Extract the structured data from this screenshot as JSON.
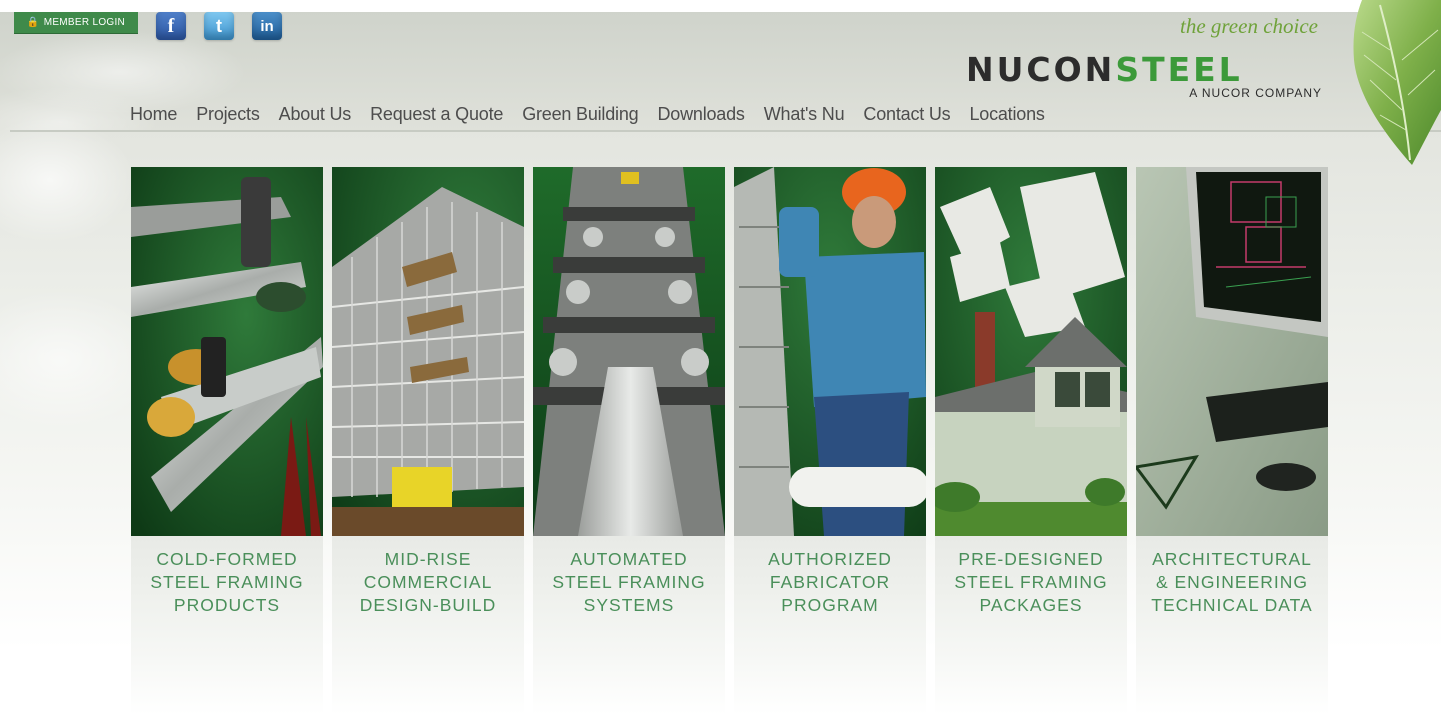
{
  "header": {
    "member_login": "MEMBER LOGIN",
    "social": [
      {
        "name": "facebook",
        "glyph": "f"
      },
      {
        "name": "twitter",
        "glyph": "t"
      },
      {
        "name": "linkedin",
        "glyph": "in"
      }
    ],
    "tagline": "the green choice",
    "logo": {
      "part1": "NUCON",
      "part2": "STEEL",
      "sub": "A NUCOR COMPANY"
    }
  },
  "nav": [
    "Home",
    "Projects",
    "About Us",
    "Request a Quote",
    "Green Building",
    "Downloads",
    "What's Nu",
    "Contact Us",
    "Locations"
  ],
  "panels": [
    {
      "lines": [
        "COLD-FORMED",
        "STEEL FRAMING",
        "PRODUCTS"
      ],
      "image": "cold-formed-steel-framing-photo"
    },
    {
      "lines": [
        "MID-RISE",
        "COMMERCIAL",
        "DESIGN-BUILD"
      ],
      "image": "mid-rise-building-photo"
    },
    {
      "lines": [
        "AUTOMATED",
        "STEEL FRAMING",
        "SYSTEMS"
      ],
      "image": "roll-forming-machine-photo"
    },
    {
      "lines": [
        "AUTHORIZED",
        "FABRICATOR",
        "PROGRAM"
      ],
      "image": "construction-worker-photo"
    },
    {
      "lines": [
        "PRE-DESIGNED",
        "STEEL FRAMING",
        "PACKAGES"
      ],
      "image": "house-floorplan-photo"
    },
    {
      "lines": [
        "ARCHITECTURAL",
        "& ENGINEERING",
        "TECHNICAL DATA"
      ],
      "image": "cad-computer-photo"
    }
  ],
  "colors": {
    "brand_green": "#3c9a3a",
    "caption_green": "#4a8f5a",
    "panel_green": "#1f5a2a",
    "tagline_green": "#6fa23a"
  }
}
